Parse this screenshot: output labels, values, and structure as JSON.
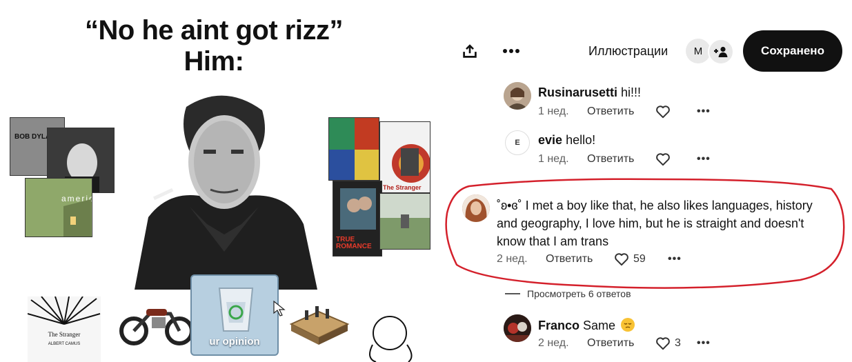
{
  "meme": {
    "title_line1": "“No he aint got rizz”",
    "title_line2": "Him:",
    "album_text_1": "BOB DYLAN",
    "album_text_2": "americ",
    "stranger_label": "The Stranger",
    "true_romance": "TRUE ROMANCE",
    "book_title": "The Stranger",
    "book_author": "ALBERT CAMUS",
    "opinion_label": "ur opinion"
  },
  "toolbar": {
    "share_icon": "share-icon",
    "more_icon": "more-icon",
    "board_name": "Иллюстрации",
    "avatar_initial": "M",
    "add_collaborator_icon": "add-person-icon",
    "saved_label": "Сохранено"
  },
  "comments": [
    {
      "author": "Rusinarusetti",
      "text": "hi!!!",
      "time": "1 нед.",
      "reply": "Ответить",
      "likes": ""
    },
    {
      "author": "evie",
      "avatar_initial": "E",
      "text": "hello!",
      "time": "1 нед.",
      "reply": "Ответить",
      "likes": ""
    },
    {
      "author": "˚ʚ•ɞ˚",
      "text": "I met a boy like that, he also likes languages, history and geography, I love him, but he is straight and doesn't know that I am trans",
      "time": "2 нед.",
      "reply": "Ответить",
      "likes": "59"
    },
    {
      "author": "Franco",
      "text": "Same",
      "time": "2 нед.",
      "reply": "Ответить",
      "likes": "3"
    }
  ],
  "view_replies": "Просмотреть 6 ответов",
  "colors": {
    "highlight": "#d4202b",
    "button": "#111111",
    "muted": "#5f5f5f"
  }
}
